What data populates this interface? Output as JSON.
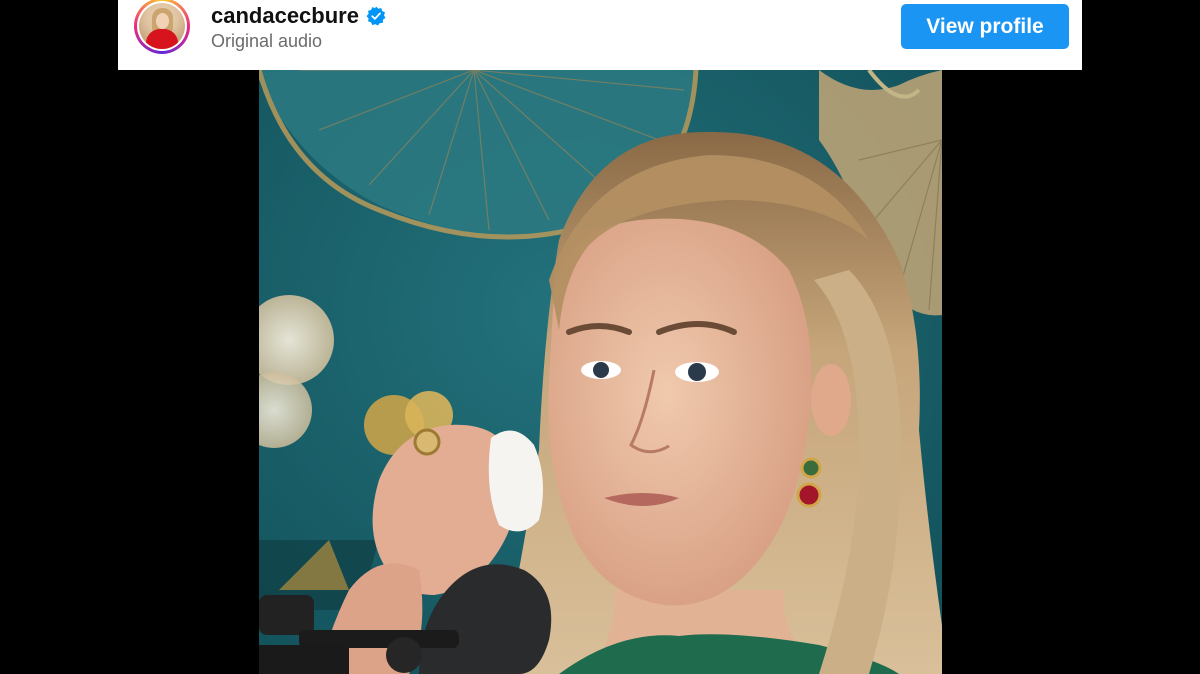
{
  "header": {
    "username": "candacecbure",
    "subtitle": "Original audio",
    "view_profile_label": "View profile",
    "verified_icon": "verified-badge-icon",
    "avatar": "profile-avatar"
  },
  "colors": {
    "button_bg": "#1a95f3",
    "verified": "#0095f6",
    "backdrop_teal": "#1d6a75",
    "letterbox": "#000000"
  },
  "video": {
    "content": "video-frame"
  }
}
